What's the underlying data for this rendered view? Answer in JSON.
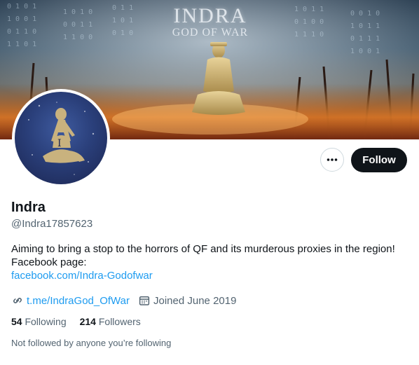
{
  "banner": {
    "title": "INDRA",
    "subtitle": "GOD OF WAR"
  },
  "profile": {
    "display_name": "Indra",
    "handle": "@Indra17857623",
    "bio_line1": "Aiming to bring a stop to the horrors of QF and its murderous proxies in the region!",
    "bio_line2": "Facebook page:",
    "bio_link": "facebook.com/Indra-Godofwar",
    "website": "t.me/IndraGod_OfWar",
    "joined": "Joined June 2019",
    "following_count": "54",
    "following_label": "Following",
    "followers_count": "214",
    "followers_label": "Followers",
    "not_followed": "Not followed by anyone you’re following"
  },
  "actions": {
    "more_icon": "more-horizontal-icon",
    "follow_label": "Follow"
  },
  "icons": {
    "website": "link-icon",
    "joined": "calendar-icon"
  },
  "colors": {
    "link": "#1d9bf0",
    "text": "#0f1419",
    "secondary": "#536471",
    "follow_bg": "#0f1419"
  }
}
